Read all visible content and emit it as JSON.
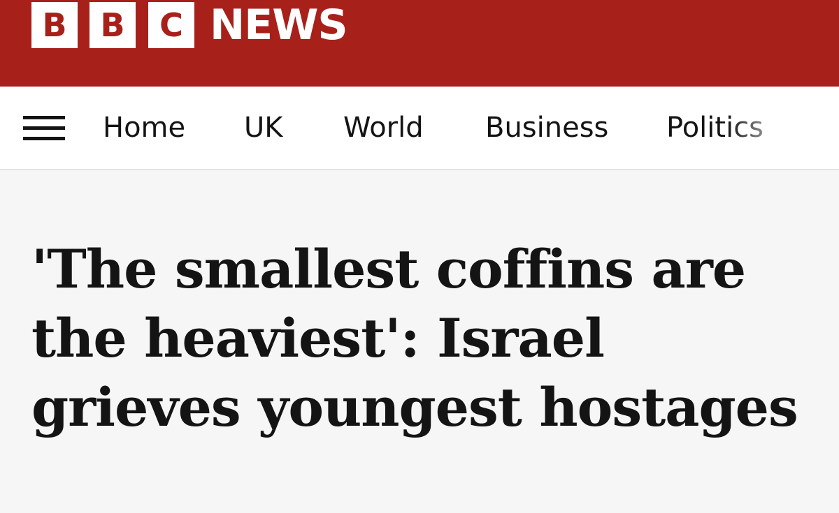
{
  "masthead": {
    "bbc_letters": [
      "B",
      "B",
      "C"
    ],
    "news": "NEWS",
    "brand_color": "#a8201a"
  },
  "nav": {
    "menu_icon": "hamburger-menu-icon",
    "items": [
      "Home",
      "UK",
      "World",
      "Business",
      "Politics"
    ]
  },
  "article": {
    "headline": "'The smallest coffins are the heaviest': Israel grieves youngest hostages"
  }
}
